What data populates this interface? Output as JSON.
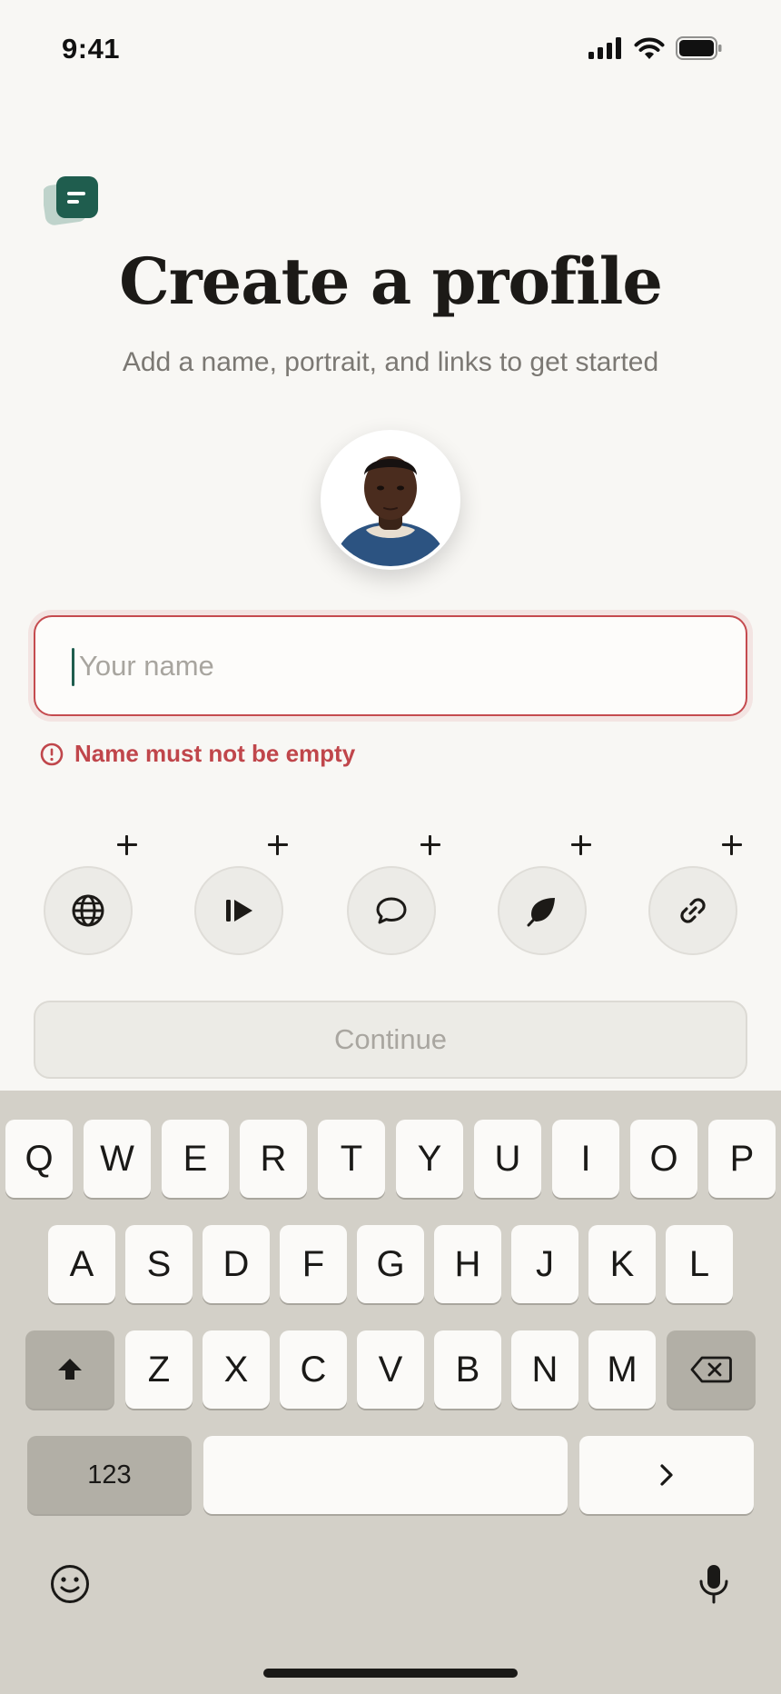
{
  "status_bar": {
    "time": "9:41",
    "icons": [
      "cellular-signal-icon",
      "wifi-icon",
      "battery-icon"
    ]
  },
  "app": {
    "logo_icon": "app-logo-icon",
    "accent_color": "#1f5d4e"
  },
  "header": {
    "title": "Create a profile",
    "subtitle": "Add a name, portrait, and links to get started"
  },
  "avatar": {
    "kind": "profile-portrait"
  },
  "name_field": {
    "value": "",
    "placeholder": "Your name",
    "state": "error",
    "border_color": "#c54b4f"
  },
  "error": {
    "message": "Name must not be empty",
    "icon": "alert-circle-icon",
    "color": "#c0464b"
  },
  "links": [
    {
      "icon": "globe-icon",
      "action": "add"
    },
    {
      "icon": "play-icon",
      "action": "add"
    },
    {
      "icon": "chat-bubble-icon",
      "action": "add"
    },
    {
      "icon": "leaf-icon",
      "action": "add"
    },
    {
      "icon": "link-icon",
      "action": "add"
    }
  ],
  "continue_button": {
    "label": "Continue",
    "enabled": false
  },
  "keyboard": {
    "row1": [
      "Q",
      "W",
      "E",
      "R",
      "T",
      "Y",
      "U",
      "I",
      "O",
      "P"
    ],
    "row2": [
      "A",
      "S",
      "D",
      "F",
      "G",
      "H",
      "J",
      "K",
      "L"
    ],
    "row3": [
      "Z",
      "X",
      "C",
      "V",
      "B",
      "N",
      "M"
    ],
    "numbers_label": "123",
    "shift_icon": "shift-icon",
    "delete_icon": "backspace-icon",
    "return_icon": "chevron-right-icon",
    "emoji_icon": "emoji-icon",
    "mic_icon": "microphone-icon"
  }
}
